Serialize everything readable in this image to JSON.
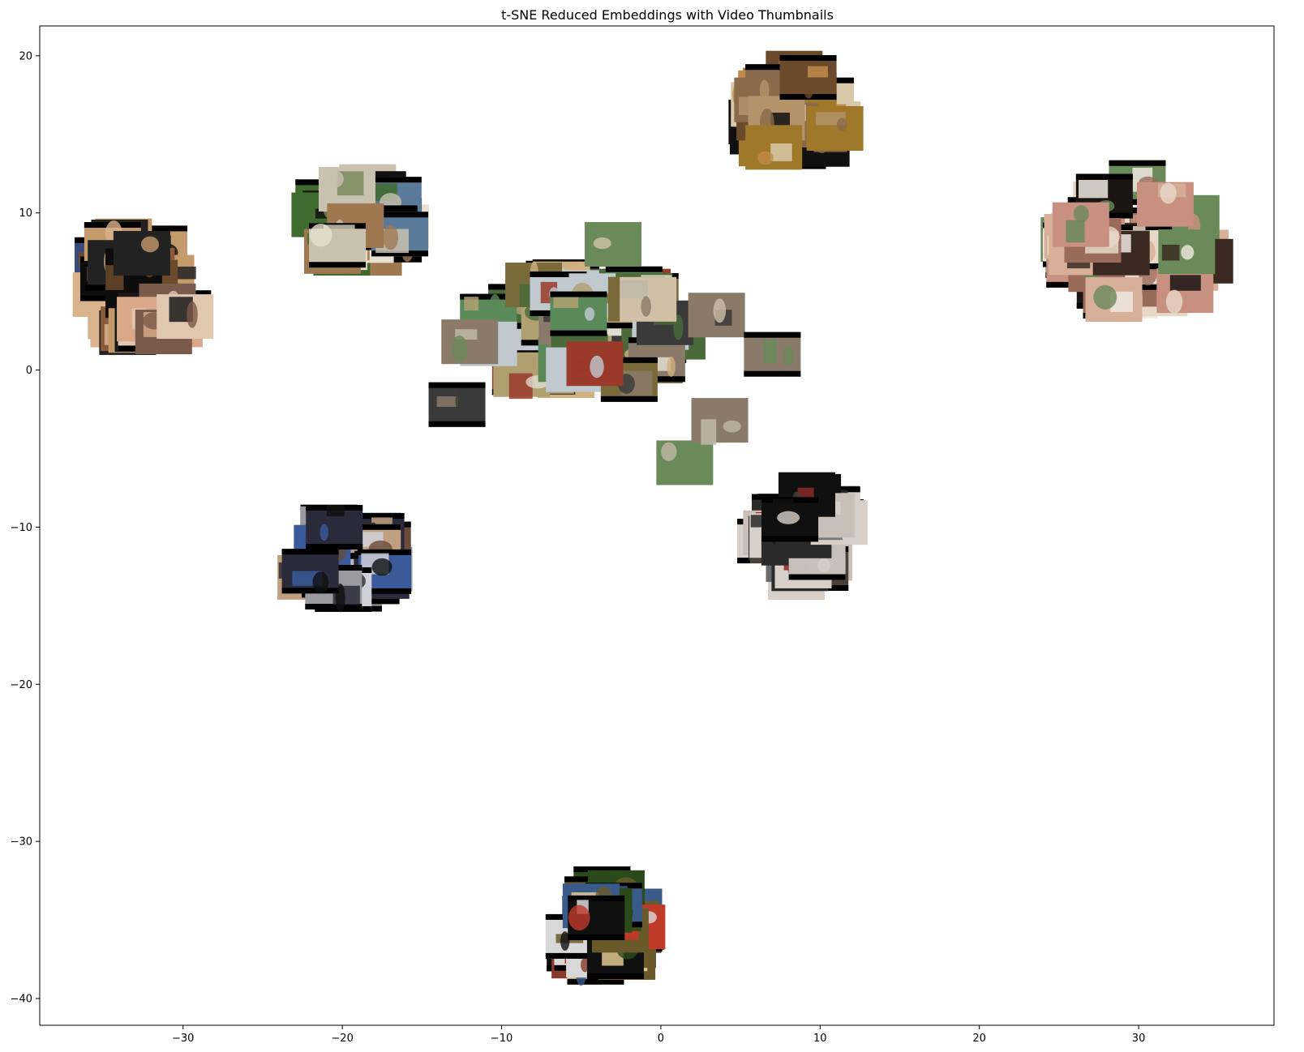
{
  "chart_data": {
    "type": "scatter",
    "title": "t-SNE Reduced Embeddings with Video Thumbnails",
    "xlabel": "",
    "ylabel": "",
    "xlim": [
      -39,
      38.5
    ],
    "ylim": [
      -41.7,
      21.9
    ],
    "grid": false,
    "legend": "none",
    "x_ticks": [
      -30,
      -20,
      -10,
      0,
      10,
      20,
      30
    ],
    "y_ticks": [
      20,
      10,
      0,
      -10,
      -20,
      -30,
      -40
    ],
    "x_tick_labels": [
      "−30",
      "−20",
      "−10",
      "0",
      "10",
      "20",
      "30"
    ],
    "y_tick_labels": [
      "20",
      "10",
      "0",
      "−10",
      "−20",
      "−30",
      "−40"
    ],
    "marker": "video thumbnail image",
    "clusters": [
      {
        "x": -33,
        "y": 5.5,
        "spread": [
          2.4,
          3.2
        ],
        "count": 34,
        "palette": [
          "#0d0d0d",
          "#6b4a2a",
          "#c49a6c",
          "#3a4a7a",
          "#d9b38c",
          "#222222",
          "#8a5a3a"
        ]
      },
      {
        "x": -19,
        "y": 9.5,
        "spread": [
          3.2,
          2.4
        ],
        "count": 30,
        "palette": [
          "#3f6b2f",
          "#c9c2b0",
          "#7a8a5a",
          "#111111",
          "#a07850",
          "#e8e0d0",
          "#5a7a9a"
        ]
      },
      {
        "x": -31.5,
        "y": 3.2,
        "spread": [
          1.8,
          1.2
        ],
        "count": 10,
        "palette": [
          "#b8866a",
          "#d8a888",
          "#7a5a4a",
          "#e0c8b0",
          "#1a1a1a"
        ]
      },
      {
        "x": -5,
        "y": 2.5,
        "spread": [
          6.5,
          3.6
        ],
        "count": 70,
        "palette": [
          "#7a6a3a",
          "#b0a070",
          "#e0dcd0",
          "#4a6a3a",
          "#8a7a6a",
          "#c0c8d0",
          "#3a3a3a",
          "#9a3a2a",
          "#d0b080",
          "#5a8a5a"
        ]
      },
      {
        "x": 8.5,
        "y": 16,
        "spread": [
          2.5,
          3.0
        ],
        "count": 28,
        "palette": [
          "#a0782a",
          "#c08a4a",
          "#6a4a2a",
          "#d8c8a8",
          "#101010",
          "#b4926a",
          "#8a6a4a"
        ]
      },
      {
        "x": 30,
        "y": 8,
        "spread": [
          4.5,
          4.2
        ],
        "count": 42,
        "palette": [
          "#d8b09a",
          "#3a2a22",
          "#c89080",
          "#e8d8c8",
          "#1a1412",
          "#9a6a5a",
          "#f0e8e0",
          "#6a8a5a"
        ]
      },
      {
        "x": -20,
        "y": -12,
        "spread": [
          3.0,
          2.2
        ],
        "count": 32,
        "palette": [
          "#101010",
          "#3a5a9a",
          "#c0a080",
          "#2a2a3a",
          "#9a9aa0",
          "#d0d0d8",
          "#6a4a3a"
        ]
      },
      {
        "x": 9,
        "y": -10.5,
        "spread": [
          2.5,
          2.8
        ],
        "count": 28,
        "palette": [
          "#101010",
          "#4a4038",
          "#c8c0b8",
          "#8a2a2a",
          "#6a6a6a",
          "#d8d0c8",
          "#2a2a2a"
        ]
      },
      {
        "x": -3.5,
        "y": -35.5,
        "spread": [
          2.4,
          2.5
        ],
        "count": 34,
        "palette": [
          "#2a4a1a",
          "#101010",
          "#c03a2a",
          "#3a5a8a",
          "#d8d8d8",
          "#6a5a2a",
          "#8a3a2a",
          "#e0c890"
        ]
      }
    ],
    "points": [
      {
        "x": -0.8,
        "y": 4.5
      },
      {
        "x": 3.5,
        "y": 3.5
      },
      {
        "x": 1.5,
        "y": -5.9
      },
      {
        "x": 3.7,
        "y": -3.2
      },
      {
        "x": -3.0,
        "y": 8.0
      },
      {
        "x": 7.0,
        "y": 1.0
      },
      {
        "x": -12.0,
        "y": 1.8
      },
      {
        "x": -12.8,
        "y": -2.2
      }
    ]
  }
}
